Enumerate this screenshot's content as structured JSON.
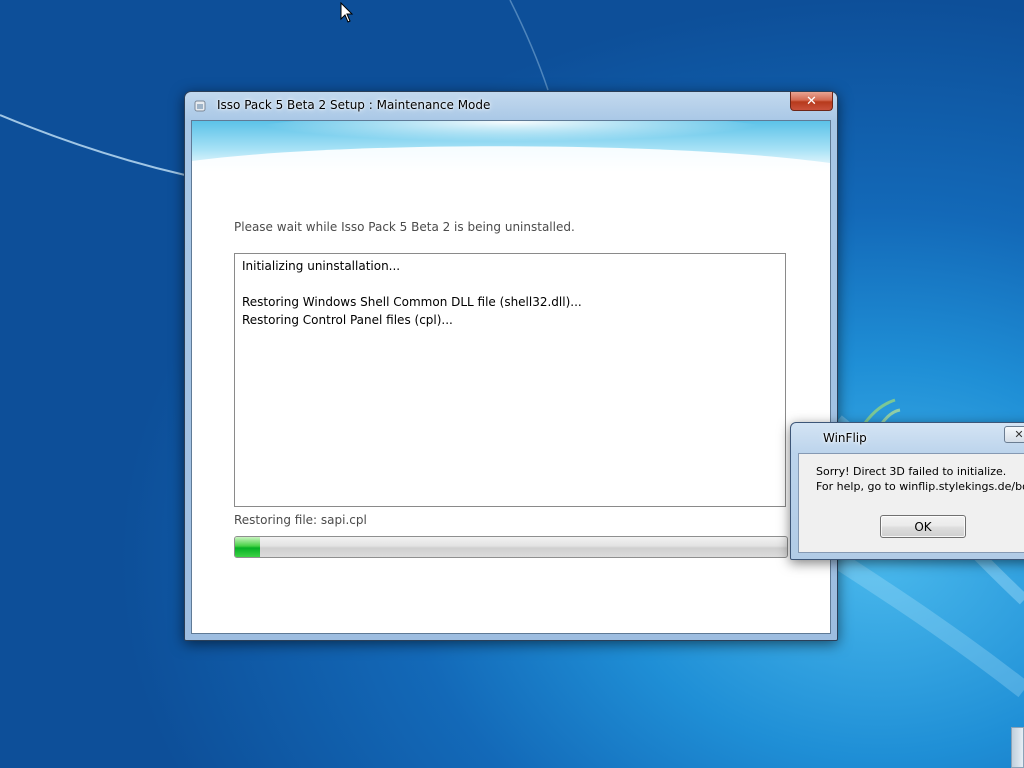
{
  "setup_window": {
    "title": "Isso Pack 5 Beta 2 Setup : Maintenance Mode",
    "close_glyph": "✕",
    "icon": "installer-app-icon",
    "status_message": "Please wait while Isso Pack 5 Beta 2 is being uninstalled.",
    "log_lines": [
      "Initializing uninstallation...",
      "",
      "Restoring Windows Shell Common DLL file (shell32.dll)...",
      "Restoring Control Panel files (cpl)..."
    ],
    "current_file": "Restoring file: sapi.cpl",
    "progress_fraction": 0.045,
    "progress_color": "#06b025"
  },
  "winflip_dialog": {
    "title": "WinFlip",
    "close_glyph": "✕",
    "message_line1": "Sorry! Direct 3D failed to initialize.",
    "message_line2": "For help, go to winflip.stylekings.de/boa",
    "ok_label": "OK"
  },
  "desktop": {
    "background_color": "#1369b8",
    "cursor_icon": "mouse-pointer-icon"
  }
}
